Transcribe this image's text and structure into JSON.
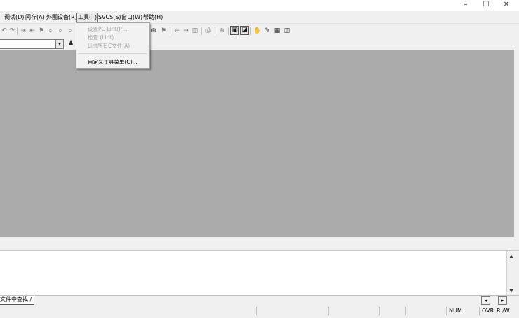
{
  "window_controls": {
    "minimize": "–",
    "maximize": "☐",
    "close": "✕"
  },
  "menubar": {
    "items": [
      {
        "label": "调试(D)"
      },
      {
        "label": "闪存(A)"
      },
      {
        "label": "外围设备(R)"
      },
      {
        "label": "工具(T)"
      },
      {
        "label": "SVCS(S)"
      },
      {
        "label": "窗口(W)"
      },
      {
        "label": "帮助(H)"
      }
    ]
  },
  "toolbar": {
    "icons": {
      "undo": "↶",
      "redo": "↷",
      "indent": "⇥",
      "outdent": "⇤",
      "bookmark": "⚑",
      "find": "⌕",
      "back": "←",
      "forward": "→",
      "print": "⎙",
      "zoom": "⊕",
      "toggle1": "▣",
      "toggle2": "◪",
      "hand": "✋",
      "tag": "✎",
      "grid": "▦",
      "window": "◫",
      "user": "♟"
    }
  },
  "combo": {
    "value": "",
    "dropdown_arrow": "▾"
  },
  "tools_menu": {
    "items": [
      {
        "label": "设置PC-Lint(P)...",
        "enabled": false
      },
      {
        "label": "检查 (Lint)",
        "enabled": false
      },
      {
        "label": "Lint所有C文件(A)",
        "enabled": false
      },
      {
        "label": "自定义工具菜单(C)...",
        "enabled": true
      }
    ]
  },
  "output": {
    "tabs": [
      {
        "label": "文件中查找 /"
      }
    ],
    "scroll_up": "▲",
    "scroll_down": "▼",
    "scroll_left": "◂",
    "scroll_right": "▸"
  },
  "statusbar": {
    "num": "NUM",
    "ovr": "OVR",
    "rw": "R /W"
  }
}
